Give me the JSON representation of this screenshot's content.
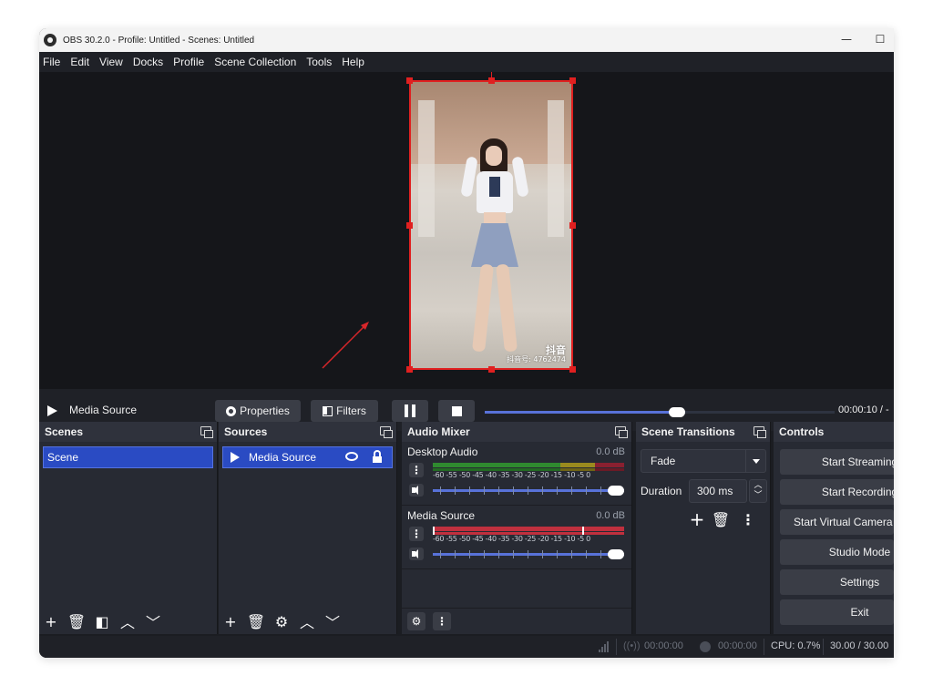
{
  "window": {
    "title": "OBS 30.2.0 - Profile: Untitled - Scenes: Untitled",
    "minimize_glyph": "—",
    "maximize_glyph": "☐"
  },
  "menu": [
    "File",
    "Edit",
    "View",
    "Docks",
    "Profile",
    "Scene Collection",
    "Tools",
    "Help"
  ],
  "preview": {
    "watermark_line1": "抖音",
    "watermark_line2": "抖音号: 4762474"
  },
  "media_controls": {
    "source_name": "Media Source",
    "properties_label": "Properties",
    "filters_label": "Filters",
    "time_text": "00:00:10 / -",
    "seek_fraction": 0.55
  },
  "scenes": {
    "title": "Scenes",
    "items": [
      "Scene"
    ]
  },
  "sources": {
    "title": "Sources",
    "items": [
      "Media Source"
    ]
  },
  "audio_mixer": {
    "title": "Audio Mixer",
    "channels": [
      {
        "name": "Desktop Audio",
        "db": "0.0 dB",
        "volume_fraction": 1.0
      },
      {
        "name": "Media Source",
        "db": "0.0 dB",
        "volume_fraction": 1.0
      }
    ],
    "scale_text": "-60 -55 -50 -45 -40 -35 -30 -25 -20 -15 -10  -5   0"
  },
  "transitions": {
    "title": "Scene Transitions",
    "selected": "Fade",
    "duration_label": "Duration",
    "duration_value": "300 ms"
  },
  "controls": {
    "title": "Controls",
    "buttons": [
      "Start Streaming",
      "Start Recording",
      "Start Virtual Camera",
      "Studio Mode",
      "Settings",
      "Exit"
    ]
  },
  "status": {
    "stream_time": "00:00:00",
    "record_time": "00:00:00",
    "cpu": "CPU: 0.7%",
    "fps": "30.00 / 30.00"
  },
  "colors": {
    "accent": "#2a4bc3",
    "selection_border": "#e02020",
    "slider": "#5872d9",
    "meter_green": "#2f8a2f",
    "meter_yellow": "#9a8a1e",
    "meter_red": "#c0303e"
  },
  "icons": {
    "play": "play-icon",
    "pause": "pause-icon",
    "stop": "stop-icon",
    "eye": "eye-icon",
    "lock": "lock-icon",
    "gear": "gear-icon",
    "add": "plus-icon",
    "remove": "trash-icon",
    "filter": "filter-icon",
    "up": "chevron-up-icon",
    "down": "chevron-down-icon",
    "kebab": "kebab-icon",
    "speaker": "speaker-icon",
    "undock": "undock-icon"
  }
}
